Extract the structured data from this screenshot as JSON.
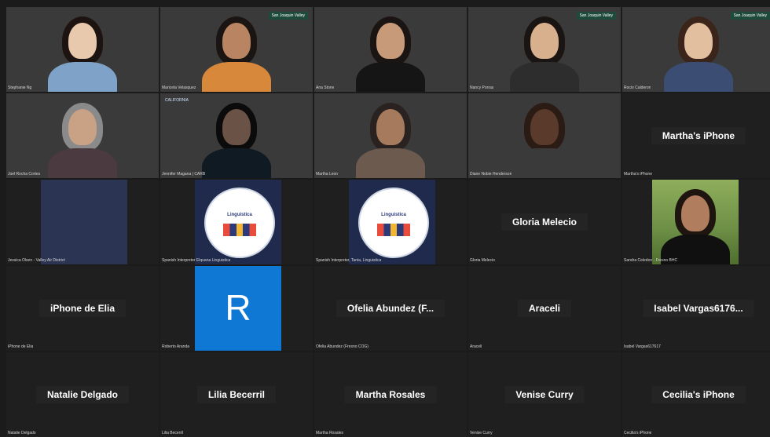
{
  "meeting": {
    "tiles": [
      {
        "kind": "video",
        "name": "Stephanie Ng",
        "bg": "bg-room1",
        "skin": "#e8c9ad",
        "hair": "#1d1411",
        "shirt": "#7fa3c8"
      },
      {
        "kind": "video",
        "name": "Maricela Velasquez",
        "bg": "bg-mountains",
        "skin": "#b88462",
        "hair": "#1a1412",
        "shirt": "#d8883a",
        "badge": "San Joaquin Valley"
      },
      {
        "kind": "video",
        "name": "Ana Stone",
        "bg": "bg-room2",
        "skin": "#c79a7a",
        "hair": "#1a1412",
        "shirt": "#151515"
      },
      {
        "kind": "video",
        "name": "Nancy Porras",
        "bg": "bg-valley",
        "skin": "#d9b08e",
        "hair": "#1a1412",
        "shirt": "#2d2d2d",
        "badge": "San Joaquin Valley"
      },
      {
        "kind": "video",
        "name": "Rocio Calderon",
        "bg": "bg-navy",
        "skin": "#e2bf9f",
        "hair": "#3b241a",
        "shirt": "#3c4d73",
        "badge": "San Joaquin Valley"
      },
      {
        "kind": "video",
        "name": "Joel Rocha Cortes",
        "bg": "bg-shelf",
        "skin": "#c9a285",
        "hair": "#8a8a8a",
        "shirt": "#4b3a3f"
      },
      {
        "kind": "video",
        "name": "Jennifer Magana | CARB",
        "bg": "bg-teal",
        "skin": "#6a5246",
        "hair": "#0b0b0b",
        "shirt": "#0f1a22",
        "badge2": "CALIFORNIA"
      },
      {
        "kind": "video",
        "name": "Martha Leon",
        "bg": "bg-curtain",
        "skin": "#a67a5c",
        "hair": "#2a2220",
        "shirt": "#6d5a4f"
      },
      {
        "kind": "video",
        "name": "Diane Nobie Henderson",
        "bg": "bg-softlight",
        "skin": "#5a3a2b",
        "hair": "#2a1b14",
        "shirt": "#3a3a3a"
      },
      {
        "kind": "center",
        "name": "Martha's iPhone",
        "label": "Martha's iPhone"
      },
      {
        "kind": "navy",
        "name": "Jessica Olsen - Valley Air District"
      },
      {
        "kind": "logo",
        "name": "Spanish Interpreter Elquana Linguistica",
        "logo_text": "Linguistica"
      },
      {
        "kind": "logo",
        "name": "Spanish Interpreter, Tania, Linguistica",
        "logo_text": "Linguistica"
      },
      {
        "kind": "center",
        "name": "Gloria Melecio",
        "label": "Gloria Melecio"
      },
      {
        "kind": "photo",
        "name": "Sandra Celedon - Fresno BHC",
        "bg": "bg-tree",
        "skin": "#b07e5e",
        "hair": "#1e1410",
        "shirt": "#101010"
      },
      {
        "kind": "center",
        "name": "iPhone de Elia",
        "label": "iPhone de Elia"
      },
      {
        "kind": "r",
        "name": "Roberto Aranda",
        "letter": "R"
      },
      {
        "kind": "center",
        "name": "Ofelia Abundez (Fresno COG)",
        "label": "Ofelia Abundez (F..."
      },
      {
        "kind": "center",
        "name": "Araceli",
        "label": "Araceli"
      },
      {
        "kind": "center",
        "name": "Isabel Vargas617617",
        "label": "Isabel Vargas6176..."
      },
      {
        "kind": "center",
        "name": "Natalie Delgado",
        "label": "Natalie Delgado"
      },
      {
        "kind": "center",
        "name": "Lilia Becerril",
        "label": "Lilia Becerril"
      },
      {
        "kind": "center",
        "name": "Martha Rosales",
        "label": "Martha Rosales"
      },
      {
        "kind": "center",
        "name": "Venise Curry",
        "label": "Venise Curry"
      },
      {
        "kind": "center",
        "name": "Cecilia's iPhone",
        "label": "Cecilia's iPhone"
      }
    ]
  }
}
